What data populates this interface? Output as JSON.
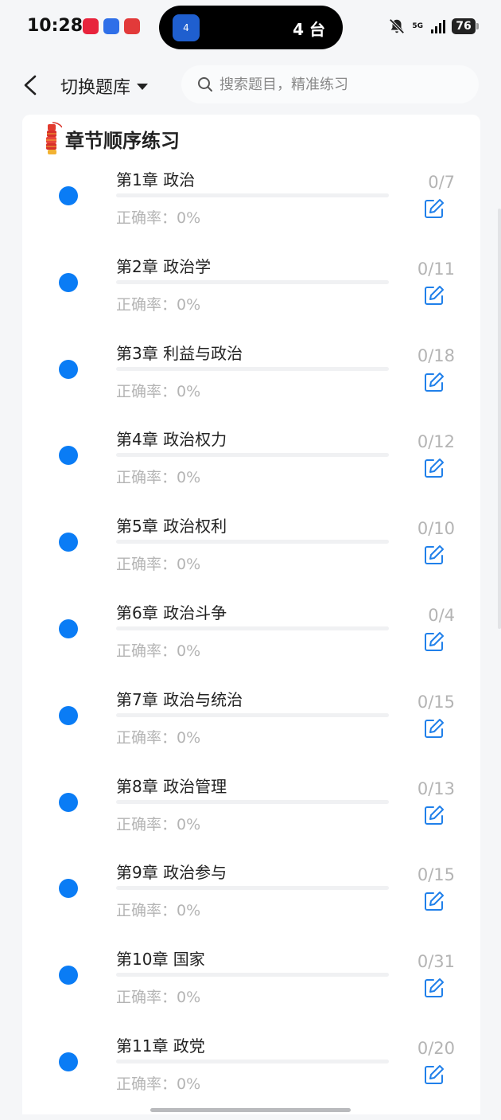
{
  "status_bar": {
    "time": "10:28",
    "island_app_badge": "4",
    "island_text": "4 台",
    "network": "5G",
    "battery": "76",
    "app_icon_colors": [
      "#e8233c",
      "#2f6fe8",
      "#e23a3a"
    ]
  },
  "header": {
    "bank_switch_label": "切换题库",
    "search_placeholder": "搜索题目，精准练习"
  },
  "section": {
    "title": "章节顺序练习"
  },
  "accuracy_prefix": "正确率：",
  "colors": {
    "accent": "#0a7cf5",
    "muted_text": "#b4b4b4",
    "background": "#f5f6f8"
  },
  "chapters": [
    {
      "title": "第1章 政治",
      "accuracy": "0%",
      "count": "0/7",
      "progress": 0
    },
    {
      "title": "第2章 政治学",
      "accuracy": "0%",
      "count": "0/11",
      "progress": 0
    },
    {
      "title": "第3章 利益与政治",
      "accuracy": "0%",
      "count": "0/18",
      "progress": 0
    },
    {
      "title": "第4章 政治权力",
      "accuracy": "0%",
      "count": "0/12",
      "progress": 0
    },
    {
      "title": "第5章 政治权利",
      "accuracy": "0%",
      "count": "0/10",
      "progress": 0
    },
    {
      "title": "第6章 政治斗争",
      "accuracy": "0%",
      "count": "0/4",
      "progress": 0
    },
    {
      "title": "第7章 政治与统治",
      "accuracy": "0%",
      "count": "0/15",
      "progress": 0
    },
    {
      "title": "第8章 政治管理",
      "accuracy": "0%",
      "count": "0/13",
      "progress": 0
    },
    {
      "title": "第9章 政治参与",
      "accuracy": "0%",
      "count": "0/15",
      "progress": 0
    },
    {
      "title": "第10章 国家",
      "accuracy": "0%",
      "count": "0/31",
      "progress": 0
    },
    {
      "title": "第11章 政党",
      "accuracy": "0%",
      "count": "0/20",
      "progress": 0
    }
  ]
}
